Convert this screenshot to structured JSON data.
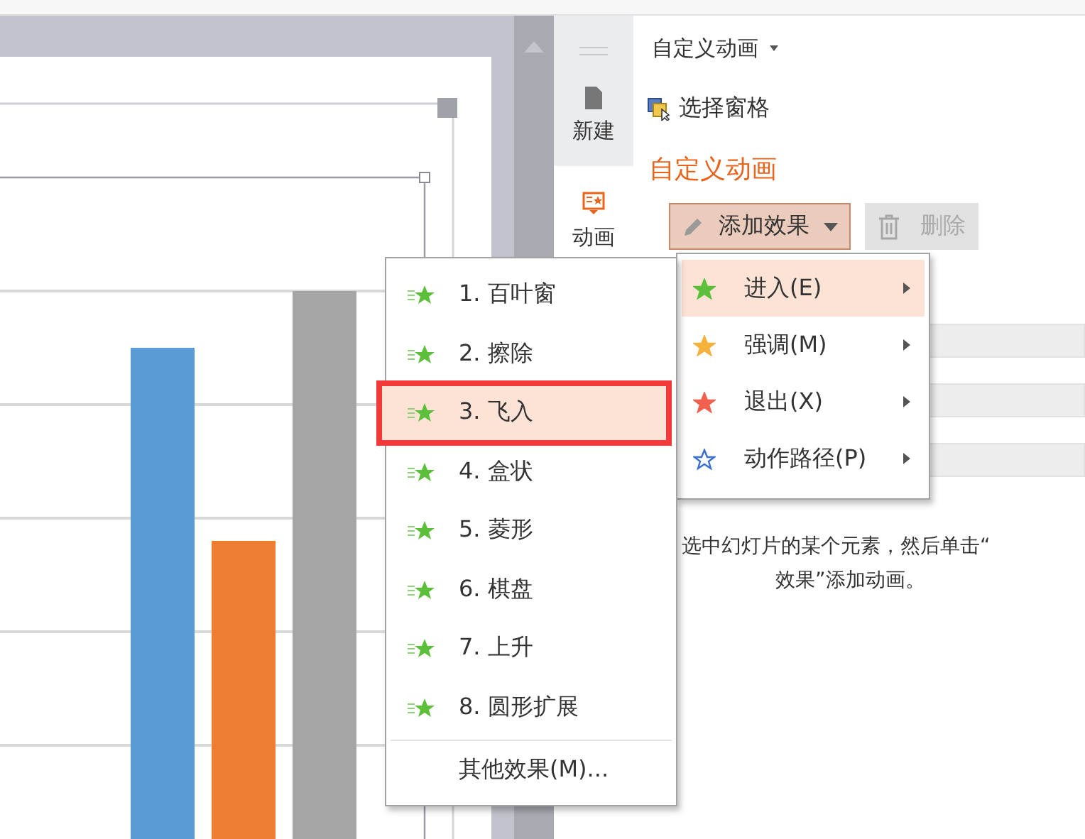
{
  "side_tabs": [
    {
      "label": "新建",
      "kind": "new",
      "selected": false
    },
    {
      "label": "动画",
      "kind": "animation",
      "selected": true
    }
  ],
  "pane": {
    "header": "自定义动画",
    "select_pane": "选择窗格",
    "title": "自定义动画",
    "add_button": {
      "label": "添加效果",
      "active": true
    },
    "delete_button": {
      "label": "删除",
      "disabled": true
    },
    "hint": [
      "选中幻灯片的某个元素，然后单击“",
      "效果”添加动画。"
    ]
  },
  "effect_menu": [
    {
      "label": "进入(E)",
      "color": "#5cbf3a",
      "selected": true
    },
    {
      "label": "强调(M)",
      "color": "#f4b13c",
      "selected": false
    },
    {
      "label": "退出(X)",
      "color": "#f0614f",
      "selected": false
    },
    {
      "label": "动作路径(P)",
      "color": "#3a6fd8",
      "selected": false
    }
  ],
  "entrance_menu": {
    "items": [
      {
        "label": "1. 百叶窗",
        "selected": false,
        "marked": false
      },
      {
        "label": "2. 擦除",
        "selected": false,
        "marked": false
      },
      {
        "label": "3. 飞入",
        "selected": true,
        "marked": true
      },
      {
        "label": "4. 盒状",
        "selected": false,
        "marked": false
      },
      {
        "label": "5. 菱形",
        "selected": false,
        "marked": false
      },
      {
        "label": "6. 棋盘",
        "selected": false,
        "marked": false
      },
      {
        "label": "7. 上升",
        "selected": false,
        "marked": false
      },
      {
        "label": "8. 圆形扩展",
        "selected": false,
        "marked": false
      }
    ],
    "more": "其他效果(M)..."
  }
}
